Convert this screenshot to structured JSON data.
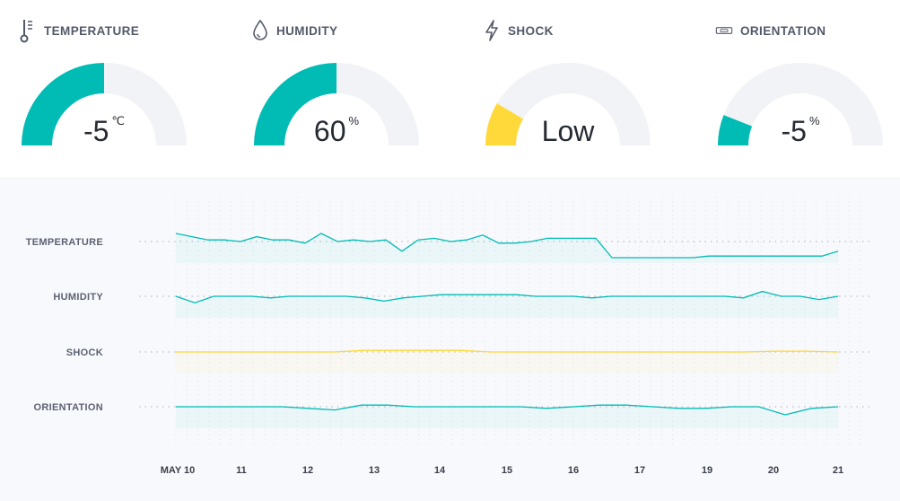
{
  "gauges": [
    {
      "id": "temperature",
      "label": "TEMPERATURE",
      "icon": "thermometer-icon",
      "value": "-5",
      "unit": "℃",
      "fill_fraction": 0.5,
      "start_fraction": 0.0,
      "color": "#00bcb4"
    },
    {
      "id": "humidity",
      "label": "HUMIDITY",
      "icon": "droplet-icon",
      "value": "60",
      "unit": "%",
      "fill_fraction": 0.5,
      "start_fraction": 0.0,
      "color": "#00bcb4"
    },
    {
      "id": "shock",
      "label": "SHOCK",
      "icon": "lightning-icon",
      "value": "Low",
      "unit": "",
      "fill_fraction": 0.17,
      "start_fraction": 0.0,
      "color": "#ffd93a"
    },
    {
      "id": "orientation",
      "label": "ORIENTATION",
      "icon": "level-icon",
      "value": "-5",
      "unit": "%",
      "fill_fraction": 0.12,
      "start_fraction": 0.0,
      "color": "#00bcb4"
    }
  ],
  "colors": {
    "accent": "#00bcb4",
    "shock": "#ffd93a",
    "track": "#f2f3f6"
  },
  "chart_data": {
    "type": "line",
    "x": [
      "MAY 10",
      "11",
      "12",
      "13",
      "14",
      "15",
      "16",
      "17",
      "19",
      "20",
      "21"
    ],
    "series": [
      {
        "name": "TEMPERATURE",
        "color": "#00bcb4",
        "values": [
          0.5,
          0.3,
          0.1,
          0.1,
          0.0,
          0.3,
          0.1,
          0.1,
          -0.1,
          0.5,
          0.0,
          0.1,
          0.0,
          0.1,
          -0.6,
          0.1,
          0.2,
          0.0,
          0.1,
          0.4,
          -0.1,
          -0.1,
          0.0,
          0.2,
          0.2,
          0.2,
          0.2,
          -1.0,
          -1.0,
          -1.0,
          -1.0,
          -1.0,
          -1.0,
          -0.9,
          -0.9,
          -0.9,
          -0.9,
          -0.9,
          -0.9,
          -0.9,
          -0.9,
          -0.6
        ]
      },
      {
        "name": "HUMIDITY",
        "color": "#00bcb4",
        "values": [
          0.0,
          -0.4,
          0.0,
          0.0,
          0.0,
          -0.1,
          0.0,
          0.0,
          0.0,
          0.0,
          -0.1,
          -0.3,
          -0.1,
          0.0,
          0.1,
          0.1,
          0.1,
          0.1,
          0.1,
          0.0,
          0.0,
          0.0,
          -0.1,
          0.0,
          0.0,
          0.0,
          0.0,
          0.0,
          0.0,
          0.0,
          -0.1,
          0.3,
          0.0,
          0.0,
          -0.2,
          0.0
        ]
      },
      {
        "name": "SHOCK",
        "color": "#ffd93a",
        "values": [
          0.0,
          0.0,
          0.0,
          0.0,
          0.0,
          0.0,
          0.1,
          0.1,
          0.1,
          0.1,
          0.0,
          0.0,
          0.0,
          0.0,
          0.0,
          0.0,
          0.0,
          0.0,
          0.0,
          0.05,
          0.05,
          0.0
        ]
      },
      {
        "name": "ORIENTATION",
        "color": "#00bcb4",
        "values": [
          0.0,
          0.0,
          0.0,
          0.0,
          0.0,
          -0.1,
          -0.2,
          0.1,
          0.1,
          0.0,
          0.0,
          0.0,
          0.0,
          0.0,
          -0.1,
          0.0,
          0.1,
          0.1,
          0.0,
          -0.1,
          -0.1,
          0.0,
          0.0,
          -0.5,
          -0.1,
          0.0
        ]
      }
    ],
    "grid": true
  }
}
